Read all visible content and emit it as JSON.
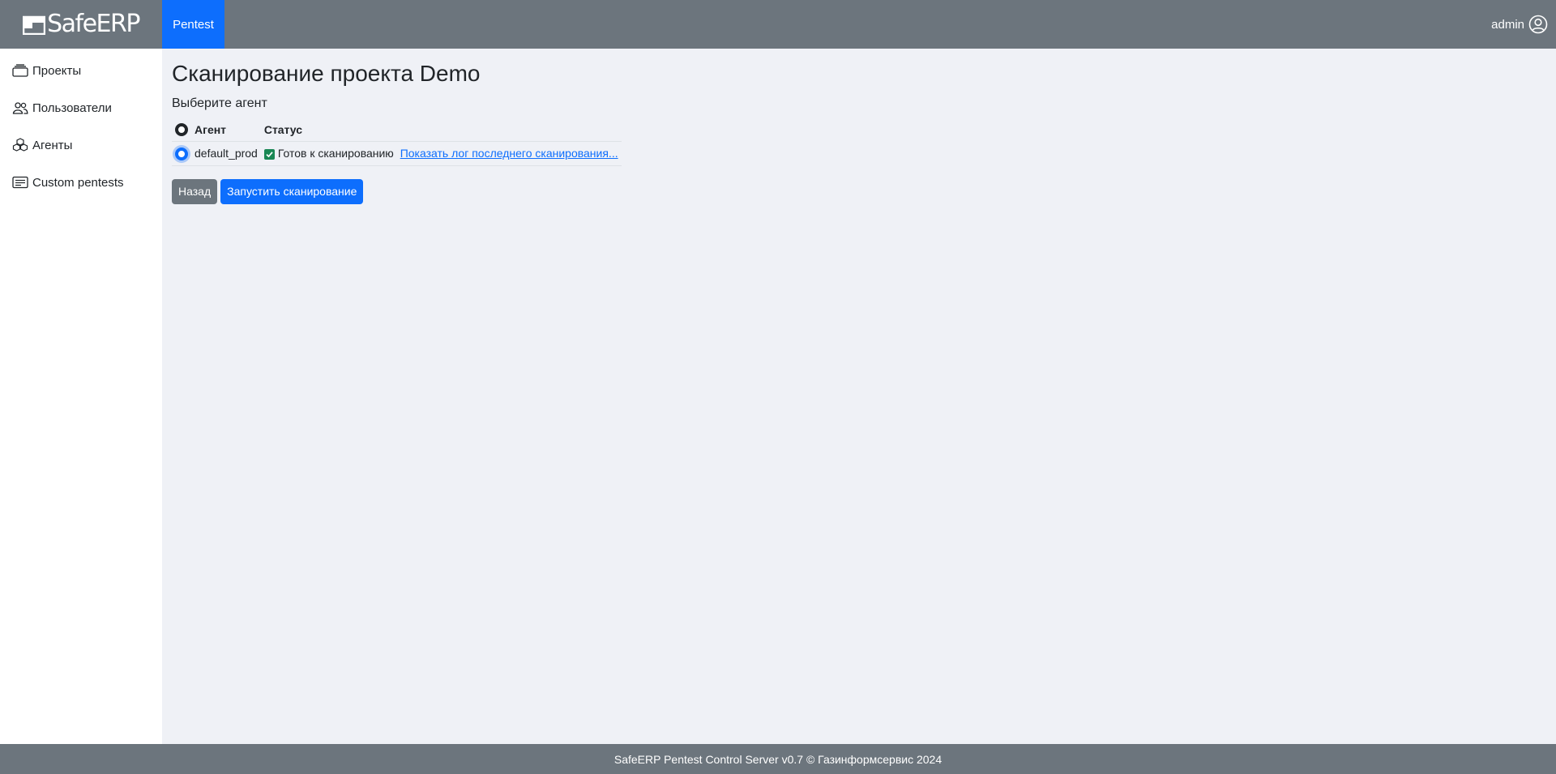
{
  "brand": {
    "name": "SafeERP"
  },
  "nav": {
    "tab_label": "Pentest"
  },
  "user": {
    "name": "admin"
  },
  "sidebar": {
    "items": [
      {
        "label": "Проекты",
        "icon": "collection-icon"
      },
      {
        "label": "Пользователи",
        "icon": "people-icon"
      },
      {
        "label": "Агенты",
        "icon": "boxes-icon"
      },
      {
        "label": "Custom pentests",
        "icon": "card-text-icon"
      }
    ]
  },
  "main": {
    "title": "Сканирование проекта Demo",
    "subtitle": "Выберите агент",
    "table": {
      "headers": {
        "agent": "Агент",
        "status": "Статус"
      },
      "rows": [
        {
          "agent": "default_prod",
          "status": "Готов к сканированию",
          "log_link": "Показать лог последнего сканирования...",
          "selected": true
        }
      ]
    },
    "buttons": {
      "back": "Назад",
      "start": "Запустить сканирование"
    }
  },
  "footer": {
    "text": "SafeERP Pentest Control Server v0.7 © Газинформсервис 2024"
  },
  "colors": {
    "navbar": "#6c757d",
    "primary": "#0d6efd",
    "background": "#eff1f6",
    "success": "#198754"
  }
}
